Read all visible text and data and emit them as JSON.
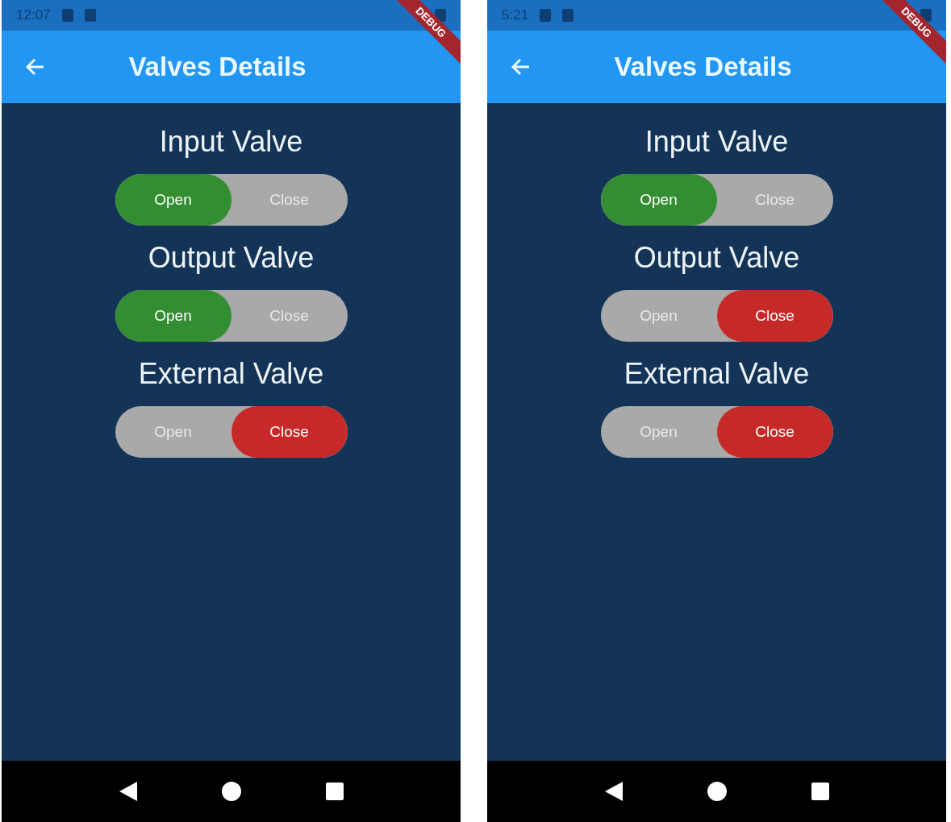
{
  "phones": [
    {
      "status_time": "12:07",
      "debug_banner": "DEBUG",
      "app_bar": {
        "title": "Valves Details"
      },
      "valves": [
        {
          "label": "Input Valve",
          "options": [
            {
              "label": "Open",
              "selected": true,
              "kind": "open"
            },
            {
              "label": "Close",
              "selected": false
            }
          ]
        },
        {
          "label": "Output Valve",
          "options": [
            {
              "label": "Open",
              "selected": true,
              "kind": "open"
            },
            {
              "label": "Close",
              "selected": false
            }
          ]
        },
        {
          "label": "External Valve",
          "options": [
            {
              "label": "Open",
              "selected": false
            },
            {
              "label": "Close",
              "selected": true,
              "kind": "close"
            }
          ]
        }
      ]
    },
    {
      "status_time": "5:21",
      "debug_banner": "DEBUG",
      "app_bar": {
        "title": "Valves Details"
      },
      "valves": [
        {
          "label": "Input Valve",
          "options": [
            {
              "label": "Open",
              "selected": true,
              "kind": "open"
            },
            {
              "label": "Close",
              "selected": false
            }
          ]
        },
        {
          "label": "Output Valve",
          "options": [
            {
              "label": "Open",
              "selected": false
            },
            {
              "label": "Close",
              "selected": true,
              "kind": "close"
            }
          ]
        },
        {
          "label": "External Valve",
          "options": [
            {
              "label": "Open",
              "selected": false
            },
            {
              "label": "Close",
              "selected": true,
              "kind": "close"
            }
          ]
        }
      ]
    }
  ]
}
